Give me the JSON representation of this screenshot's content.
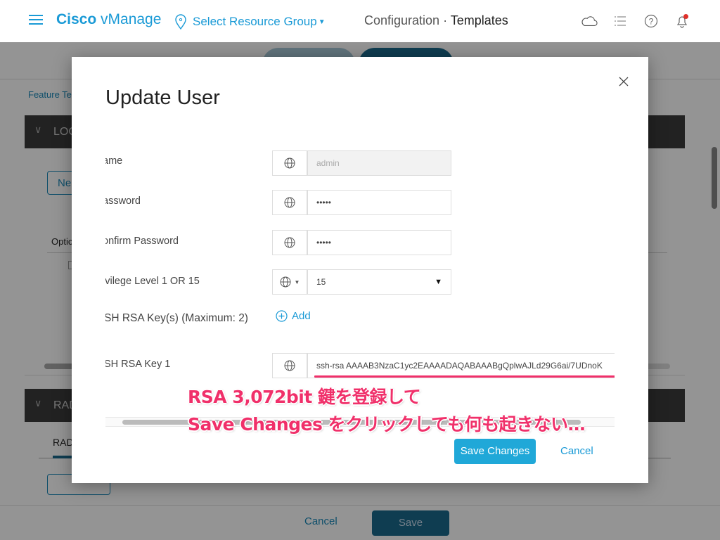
{
  "header": {
    "brand_bold": "Cisco",
    "brand_rest": " vManage",
    "resource_group": "Select Resource Group",
    "breadcrumb_parent": "Configuration",
    "breadcrumb_separator": " · ",
    "breadcrumb_current": "Templates",
    "icons": [
      "cloud-icon",
      "task-list-icon",
      "help-icon",
      "bell-icon"
    ],
    "accent_color": "#1a9ad6",
    "notification_dot_color": "#e0302a"
  },
  "background": {
    "breadcrumb": "Feature Te",
    "section1_label": "LOC",
    "new_button_label": "Ne",
    "options_header": "Optic",
    "section2_label": "RAD",
    "tab_label": "RAD",
    "footer_cancel": "Cancel",
    "footer_save": "Save"
  },
  "modal": {
    "title": "Update User",
    "fields": [
      {
        "label": "ame",
        "value": "admin",
        "disabled": true
      },
      {
        "label": "assword",
        "value": "•••••"
      },
      {
        "label": "onfirm Password",
        "value": "•••••"
      },
      {
        "label": "ivilege Level 1 OR 15",
        "value": "15"
      }
    ],
    "ssh_keys_label": "SH RSA Key(s) (Maximum: 2)",
    "add_label": "Add",
    "ssh_key1_label": "SH RSA Key 1",
    "ssh_key1_value": "ssh-rsa AAAAB3NzaC1yc2EAAAADAQABAAABgQplwAJLd29G6ai/7UDnoK",
    "save_label": "Save Changes",
    "cancel_label": "Cancel",
    "save_color": "#20a8d8"
  },
  "annotation": {
    "line1": "RSA 3,072bit 鍵を登録して",
    "line2": "Save Changes をクリックしても何も起きない…",
    "color": "#f0306a"
  }
}
